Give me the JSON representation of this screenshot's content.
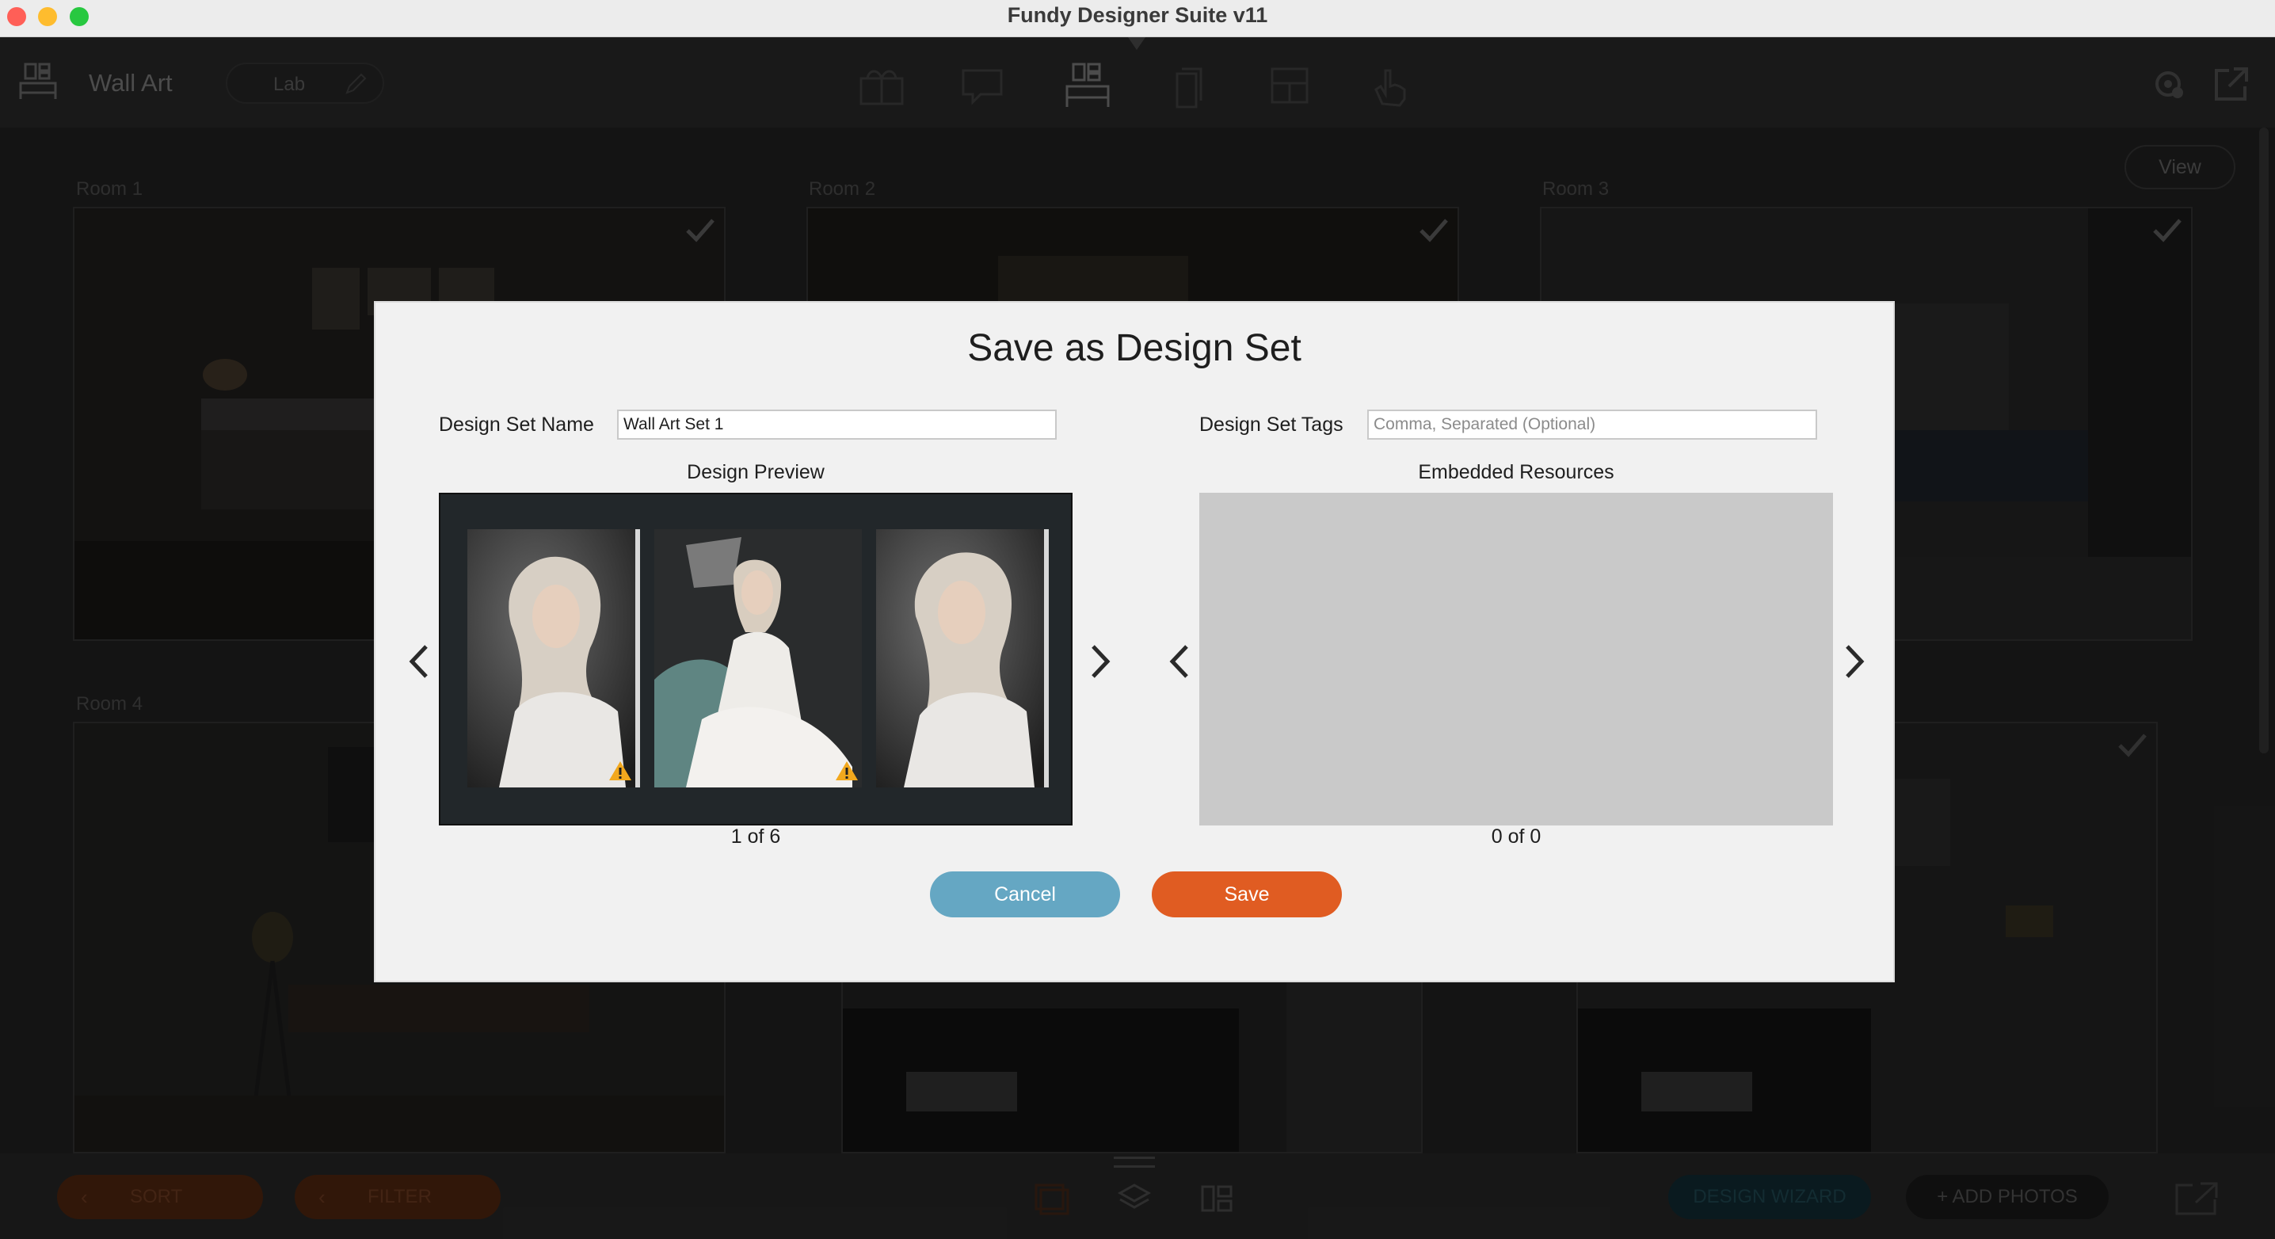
{
  "window": {
    "title": "Fundy Designer Suite v11"
  },
  "toolbar": {
    "module_name": "Wall Art",
    "lab_label": "Lab",
    "module_icons": [
      "album-icon",
      "card-icon",
      "wall-art-icon",
      "gift-box-icon",
      "layout-icon",
      "hand-icon"
    ],
    "right_icons": [
      "settings-icon",
      "export-icon"
    ]
  },
  "content": {
    "view_label": "View",
    "rooms": [
      {
        "label": "Room 1",
        "checked": true
      },
      {
        "label": "Room 2",
        "checked": true
      },
      {
        "label": "Room 3",
        "checked": true
      },
      {
        "label": "Room 4",
        "checked": false
      },
      {
        "label": "",
        "checked": false
      },
      {
        "label": "",
        "checked": true
      }
    ]
  },
  "bottombar": {
    "sort_label": "SORT",
    "filter_label": "FILTER",
    "wizard_label": "DESIGN WIZARD",
    "add_photos_label": "+ ADD PHOTOS"
  },
  "modal": {
    "title": "Save as Design Set",
    "name_label": "Design Set Name",
    "name_value": "Wall Art Set 1",
    "tags_label": "Design Set Tags",
    "tags_placeholder": "Comma, Separated (Optional)",
    "tags_value": "",
    "preview_title": "Design Preview",
    "preview_counter": "1 of 6",
    "resources_title": "Embedded Resources",
    "resources_counter": "0 of 0",
    "cancel_label": "Cancel",
    "save_label": "Save",
    "colors": {
      "cancel": "#65a7c3",
      "save": "#e05c22",
      "warning": "#f2a81d"
    }
  }
}
